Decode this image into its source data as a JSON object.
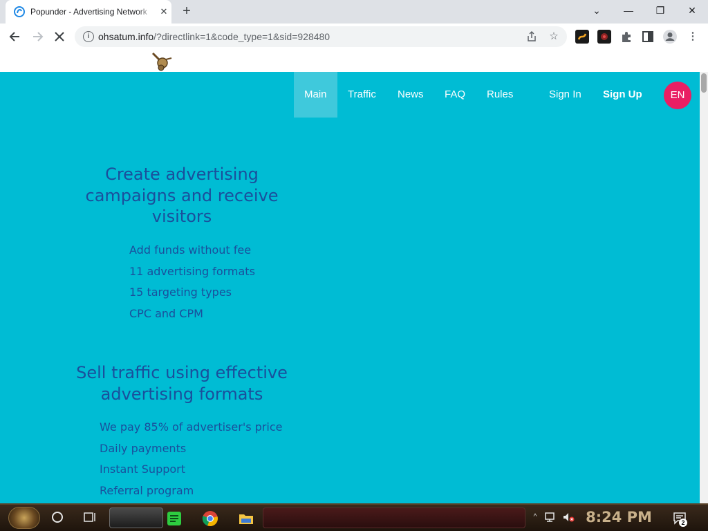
{
  "browser": {
    "tab_title": "Popunder - Advertising Network",
    "tab_close": "✕",
    "new_tab": "+",
    "window_controls": {
      "dropdown": "⌄",
      "minimize": "—",
      "restore": "❐",
      "close": "✕"
    },
    "url_host": "ohsatum.info",
    "url_rest": "/?directlink=1&code_type=1&sid=928480",
    "nav_icons": {
      "back": "arrow-left-icon",
      "forward": "arrow-right-icon",
      "stop": "close-icon"
    }
  },
  "site": {
    "nav": {
      "items": [
        "Main",
        "Traffic",
        "News",
        "FAQ",
        "Rules"
      ],
      "active": "Main",
      "sign_in": "Sign In",
      "sign_up": "Sign Up",
      "language": "EN"
    },
    "advertisers": {
      "heading": "Create advertising campaigns and receive visitors",
      "features": [
        "Add funds without fee",
        "11 advertising formats",
        "15 targeting types",
        "CPC and CPM"
      ]
    },
    "publishers": {
      "heading": "Sell traffic using effective advertising formats",
      "features": [
        "We pay 85% of advertiser's price",
        "Daily payments",
        "Instant Support",
        "Referral program"
      ]
    },
    "colors": {
      "background": "#00bcd4",
      "heading": "#1a4f9c",
      "lang_badge": "#e91e63",
      "active_nav": "#3fc9dc"
    }
  },
  "taskbar": {
    "time": "8:24 PM",
    "notification_count": "2"
  }
}
